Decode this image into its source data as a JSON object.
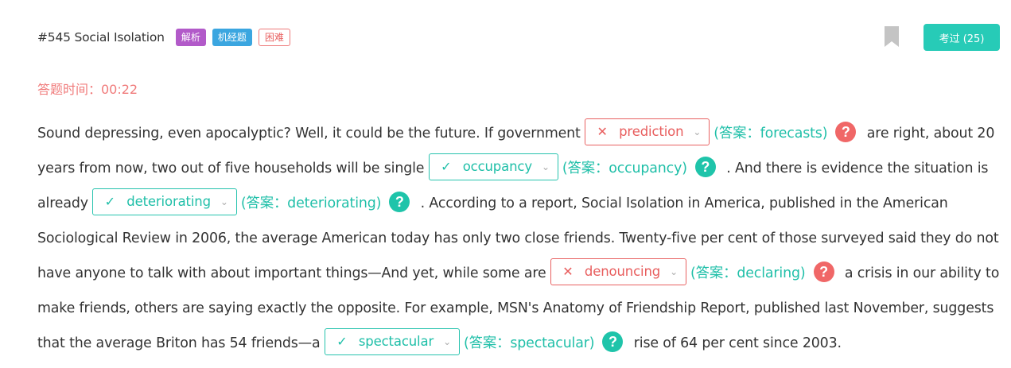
{
  "header": {
    "question_title": "#545 Social Isolation",
    "tags": [
      {
        "label": "解析",
        "kind": "analysis"
      },
      {
        "label": "机经题",
        "kind": "jijing"
      },
      {
        "label": "困难",
        "kind": "hard"
      }
    ],
    "tested_button": "考过 (25)"
  },
  "timer": {
    "text": "答题时间：00:22"
  },
  "colors": {
    "accent": "#27cbb7",
    "error": "#e86262",
    "tag_purple": "#b25ac9",
    "tag_blue": "#3ba6e0"
  },
  "passage": {
    "segments": [
      "Sound depressing, even apocalyptic? Well, it could be the future. If government ",
      " are right, about 20 years from now, two out of five households will be single ",
      " . And there is evidence the situation is already ",
      " . According to a report, Social Isolation in America, published in the American Sociological Review in 2006, the average American today has only two close friends. Twenty-five per cent of those surveyed said they do not have anyone to talk with about important things—And yet, while some are ",
      " a crisis in our ability to make friends, others are saying exactly the opposite. For example, MSN's Anatomy of Friendship Report, published last November, suggests that the average Briton has 54 friends—a ",
      " rise of 64 per cent since 2003."
    ],
    "blanks": [
      {
        "selected": "prediction",
        "answer_text": "(答案：forecasts)",
        "status": "wrong",
        "mark": "✕",
        "help_icon": "question-icon"
      },
      {
        "selected": "occupancy",
        "answer_text": "(答案：occupancy)",
        "status": "correct",
        "mark": "✓",
        "help_icon": "question-icon"
      },
      {
        "selected": "deteriorating",
        "answer_text": "(答案：deteriorating)",
        "status": "correct",
        "mark": "✓",
        "help_icon": "question-icon"
      },
      {
        "selected": "denouncing",
        "answer_text": "(答案：declaring)",
        "status": "wrong",
        "mark": "✕",
        "help_icon": "question-icon"
      },
      {
        "selected": "spectacular",
        "answer_text": "(答案：spectacular)",
        "status": "correct",
        "mark": "✓",
        "help_icon": "question-icon"
      }
    ]
  }
}
